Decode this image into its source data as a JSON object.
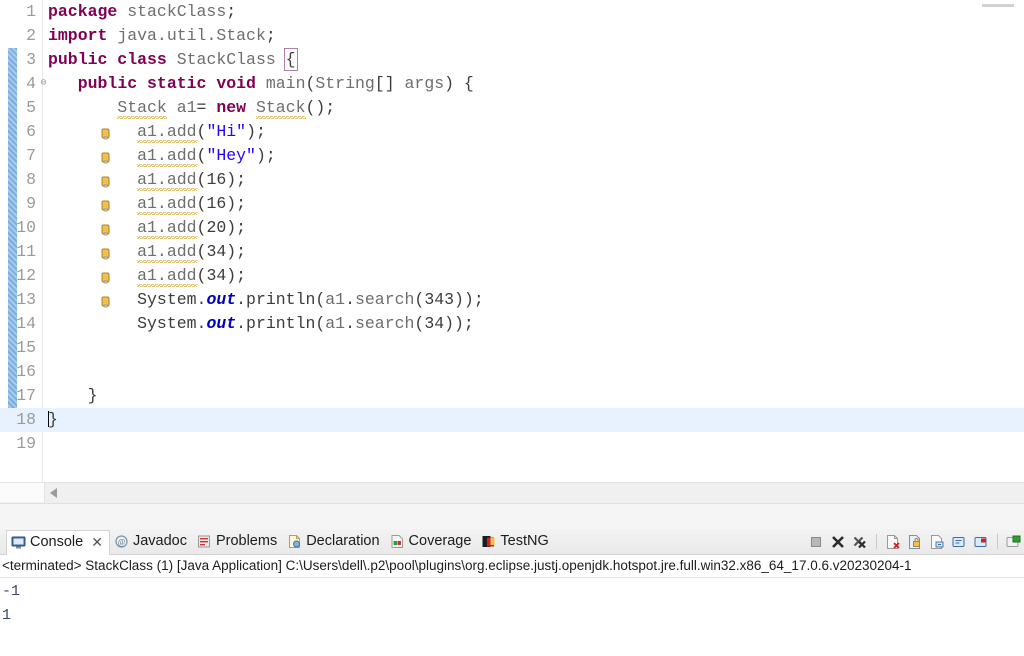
{
  "editor": {
    "name": "java-source-editor",
    "language": "java",
    "lines": [
      {
        "num": "1",
        "fold": false,
        "warn": false,
        "diff": false
      },
      {
        "num": "2",
        "fold": false,
        "warn": false,
        "diff": false
      },
      {
        "num": "3",
        "fold": false,
        "warn": false,
        "diff": true
      },
      {
        "num": "4",
        "fold": true,
        "warn": false,
        "diff": true
      },
      {
        "num": "5",
        "fold": false,
        "warn": true,
        "diff": true
      },
      {
        "num": "6",
        "fold": false,
        "warn": true,
        "diff": true
      },
      {
        "num": "7",
        "fold": false,
        "warn": true,
        "diff": true
      },
      {
        "num": "8",
        "fold": false,
        "warn": true,
        "diff": true
      },
      {
        "num": "9",
        "fold": false,
        "warn": true,
        "diff": true
      },
      {
        "num": "10",
        "fold": false,
        "warn": true,
        "diff": true
      },
      {
        "num": "11",
        "fold": false,
        "warn": true,
        "diff": true
      },
      {
        "num": "12",
        "fold": false,
        "warn": true,
        "diff": true
      },
      {
        "num": "13",
        "fold": false,
        "warn": false,
        "diff": true
      },
      {
        "num": "14",
        "fold": false,
        "warn": false,
        "diff": true
      },
      {
        "num": "15",
        "fold": false,
        "warn": false,
        "diff": true
      },
      {
        "num": "16",
        "fold": false,
        "warn": false,
        "diff": true
      },
      {
        "num": "17",
        "fold": false,
        "warn": false,
        "diff": true
      },
      {
        "num": "18",
        "fold": false,
        "warn": false,
        "diff": true
      },
      {
        "num": "19",
        "fold": false,
        "warn": false,
        "diff": false
      }
    ],
    "code_text": [
      "package stackClass;",
      "import java.util.Stack;",
      "public class StackClass {",
      "    public static void main(String[] args) {",
      "        Stack a1= new Stack();",
      "          a1.add(\"Hi\");",
      "          a1.add(\"Hey\");",
      "          a1.add(16);",
      "          a1.add(16);",
      "          a1.add(20);",
      "          a1.add(34);",
      "          a1.add(34);",
      "          System.out.println(a1.search(343));",
      "          System.out.println(a1.search(34));",
      "",
      "",
      "    }",
      "}",
      ""
    ],
    "current_line": 18,
    "colors": {
      "keyword": "#7f0055",
      "string": "#2a00ff",
      "field": "#0000c0",
      "identifier": "#6e6e6e",
      "plain": "#3c3c3c",
      "current_line_highlight": "#e8f2fe",
      "warning_underline": "#d9b64a",
      "diff_bar": "#7aaee0"
    }
  },
  "console_panel": {
    "tabs": [
      {
        "label": "Console",
        "icon": "console-icon",
        "active": true,
        "closable": true
      },
      {
        "label": "Javadoc",
        "icon": "javadoc-icon",
        "active": false,
        "closable": false
      },
      {
        "label": "Problems",
        "icon": "problems-icon",
        "active": false,
        "closable": false
      },
      {
        "label": "Declaration",
        "icon": "declaration-icon",
        "active": false,
        "closable": false
      },
      {
        "label": "Coverage",
        "icon": "coverage-icon",
        "active": false,
        "closable": false
      },
      {
        "label": "TestNG",
        "icon": "testng-icon",
        "active": false,
        "closable": false
      }
    ],
    "toolbar_icons": [
      "terminate-icon",
      "remove-launch-icon",
      "remove-all-terminated-icon",
      "clear-console-icon",
      "scroll-lock-icon",
      "show-console-on-output-icon",
      "pin-console-icon",
      "display-selected-console-icon",
      "open-console-icon"
    ],
    "status_line": "<terminated> StackClass (1) [Java Application] C:\\Users\\dell\\.p2\\pool\\plugins\\org.eclipse.justj.openjdk.hotspot.jre.full.win32.x86_64_17.0.6.v20230204-1",
    "output": [
      "-1",
      "1"
    ]
  }
}
